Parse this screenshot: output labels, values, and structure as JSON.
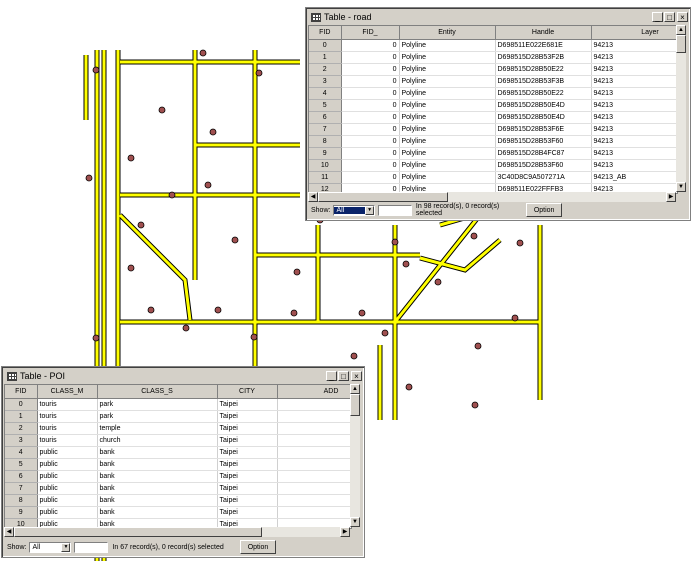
{
  "map": {
    "road_color": "#ffff00",
    "road_outline": "#000000",
    "poi_color": "#a05050"
  },
  "road_table": {
    "title": "Table - road",
    "columns": [
      "FID",
      "FID_",
      "Entity",
      "Handle",
      "Layer"
    ],
    "rows": [
      [
        "0",
        "0",
        "Polyline",
        "D698511E022E681E",
        "94213"
      ],
      [
        "1",
        "0",
        "Polyline",
        "D698515D28B53F2B",
        "94213"
      ],
      [
        "2",
        "0",
        "Polyline",
        "D698515D28B50E22",
        "94213"
      ],
      [
        "3",
        "0",
        "Polyline",
        "D698515D28B53F3B",
        "94213"
      ],
      [
        "4",
        "0",
        "Polyline",
        "D698515D28B50E22",
        "94213"
      ],
      [
        "5",
        "0",
        "Polyline",
        "D698515D28B50E4D",
        "94213"
      ],
      [
        "6",
        "0",
        "Polyline",
        "D698515D28B50E4D",
        "94213"
      ],
      [
        "7",
        "0",
        "Polyline",
        "D698515D28B53F6E",
        "94213"
      ],
      [
        "8",
        "0",
        "Polyline",
        "D698515D28B53F60",
        "94213"
      ],
      [
        "9",
        "0",
        "Polyline",
        "D698515D28B4FC87",
        "94213"
      ],
      [
        "10",
        "0",
        "Polyline",
        "D698515D28B53F60",
        "94213"
      ],
      [
        "11",
        "0",
        "Polyline",
        "3C40D8C9A507271A",
        "94213_AB"
      ],
      [
        "12",
        "0",
        "Polyline",
        "D698511E022FFFB3",
        "94213"
      ]
    ],
    "show_label": "Show:",
    "show_value": "All",
    "status": "In 98 record(s), 0 record(s) selected",
    "option_label": "Option"
  },
  "poi_table": {
    "title": "Table - POI",
    "columns": [
      "FID",
      "CLASS_M",
      "CLASS_S",
      "CITY",
      "ADD"
    ],
    "rows": [
      [
        "0",
        "touris",
        "park",
        "Taipei",
        ""
      ],
      [
        "1",
        "touris",
        "park",
        "Taipei",
        ""
      ],
      [
        "2",
        "touris",
        "temple",
        "Taipei",
        ""
      ],
      [
        "3",
        "touris",
        "church",
        "Taipei",
        ""
      ],
      [
        "4",
        "public",
        "bank",
        "Taipei",
        ""
      ],
      [
        "5",
        "public",
        "bank",
        "Taipei",
        ""
      ],
      [
        "6",
        "public",
        "bank",
        "Taipei",
        ""
      ],
      [
        "7",
        "public",
        "bank",
        "Taipei",
        ""
      ],
      [
        "8",
        "public",
        "bank",
        "Taipei",
        ""
      ],
      [
        "9",
        "public",
        "bank",
        "Taipei",
        ""
      ],
      [
        "10",
        "public",
        "bank",
        "Taipei",
        ""
      ]
    ],
    "show_label": "Show:",
    "show_value": "All",
    "status": "In 67 record(s), 0 record(s) selected",
    "option_label": "Option"
  },
  "window_buttons": {
    "minimize": "_",
    "maximize": "□",
    "close": "×"
  }
}
